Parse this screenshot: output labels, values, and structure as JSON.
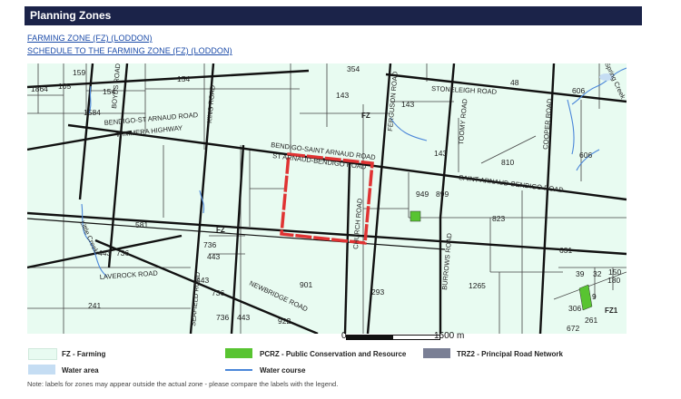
{
  "header": {
    "title": "Planning Zones"
  },
  "links": [
    "FARMING ZONE (FZ) (LODDON)",
    "SCHEDULE TO THE FARMING ZONE (FZ) (LODDON)"
  ],
  "map": {
    "roads": {
      "boyds": "BOYDS ROAD",
      "king": "KING ROAD",
      "bendigo_st_arnaud": "BENDIGO-ST ARNAUD ROAD",
      "wimmera": "WIMMERA HIGHWAY",
      "bendigo_saint_arnaud": "BENDIGO-SAINT ARNAUD ROAD",
      "st_arnaud_bendigo": "ST ARNAUD-BENDIGO ROAD",
      "saint_arnaud_bendigo": "SAINT ARNAUD-BENDIGO ROAD",
      "ferguson": "FERGUSON ROAD",
      "stoneleigh": "STONELEIGH ROAD",
      "toomy": "TOOMY ROAD",
      "cooper": "COOPER ROAD",
      "church": "CHURCH ROAD",
      "burrows": "BURROWS ROAD",
      "laverock": "LAVEROCK ROAD",
      "newbridge": "NEWBRIDGE ROAD",
      "seafield": "SEAFIELD ROAD"
    },
    "creeks": {
      "little": "Little Creek",
      "spring": "Spring Creek"
    },
    "zones": {
      "fz_a": "FZ",
      "fz_b": "FZ",
      "fz1": "FZ1"
    },
    "parcels": [
      "1864",
      "159",
      "105",
      "154",
      "154",
      "1584",
      "354",
      "143",
      "48",
      "606",
      "143",
      "143",
      "810",
      "606",
      "949",
      "899",
      "581",
      "823",
      "736",
      "631",
      "443",
      "736",
      "443",
      "39",
      "32",
      "150",
      "180",
      "241",
      "443",
      "736",
      "901",
      "293",
      "1265",
      "9",
      "736",
      "443",
      "922",
      "306",
      "261",
      "672"
    ],
    "scale": {
      "zero": "0",
      "distance": "1500 m"
    },
    "colors": {
      "farming": "#e8fbf1",
      "pcrz": "#58c431",
      "water": "#c5ddf3",
      "trz2": "#7a7f95",
      "highlight": "#e03333"
    }
  },
  "legend": {
    "fz": "FZ - Farming",
    "water_area": "Water area",
    "pcrz": "PCRZ - Public Conservation and Resource",
    "water_course": "Water course",
    "trz2": "TRZ2 - Principal Road Network"
  },
  "note": "Note: labels for zones may appear outside the actual zone - please compare the labels with the legend."
}
